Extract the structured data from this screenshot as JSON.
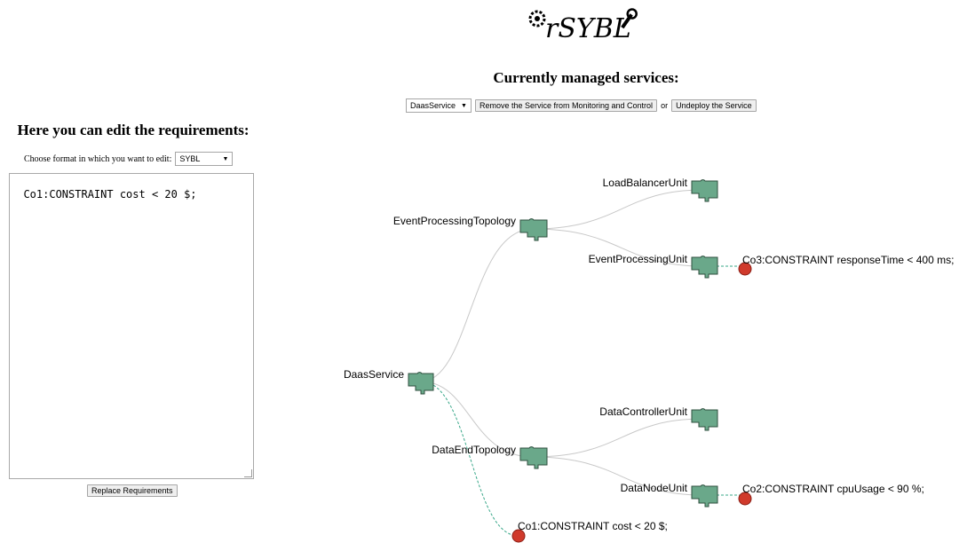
{
  "logo_text": "rSYBL",
  "managed": {
    "title": "Currently managed services:",
    "selected_service": "DaasService",
    "remove_button": "Remove the Service from Monitoring and Control",
    "or_text": "or",
    "undeploy_button": "Undeploy the Service"
  },
  "editor": {
    "title": "Here you can edit the requirements:",
    "format_label": "Choose format in which you want to edit:",
    "format_value": "SYBL",
    "requirements_text": "Co1:CONSTRAINT cost < 20 $;",
    "replace_button": "Replace Requirements"
  },
  "tree": {
    "nodes": {
      "daas": "DaasService",
      "event_topology": "EventProcessingTopology",
      "loadbalancer": "LoadBalancerUnit",
      "event_unit": "EventProcessingUnit",
      "data_topology": "DataEndTopology",
      "datacontroller": "DataControllerUnit",
      "datanode": "DataNodeUnit"
    },
    "constraints": {
      "co1": "Co1:CONSTRAINT cost < 20 $;",
      "co2": "Co2:CONSTRAINT cpuUsage < 90 %;",
      "co3": "Co3:CONSTRAINT responseTime < 400 ms;"
    },
    "colors": {
      "node_fill": "#6aa88a",
      "node_stroke": "#2f4f3f",
      "constraint_fill": "#d03a2c",
      "link": "#c8c8c8",
      "constraint_link": "#3aa88a"
    }
  }
}
